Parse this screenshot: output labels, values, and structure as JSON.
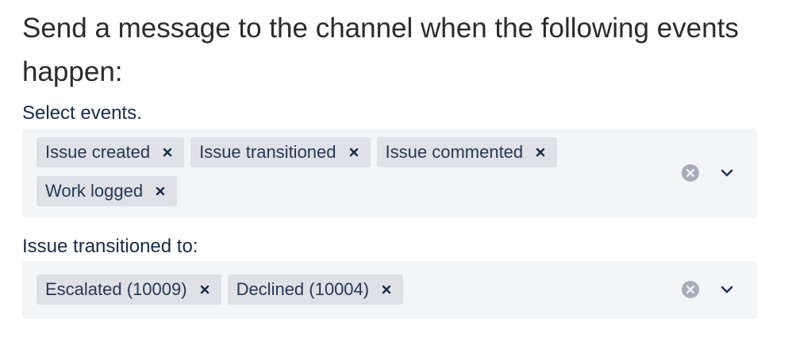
{
  "heading": "Send a message to the channel when the following events happen:",
  "events_field": {
    "label": "Select events.",
    "chips": [
      {
        "label": "Issue created"
      },
      {
        "label": "Issue transitioned"
      },
      {
        "label": "Issue commented"
      },
      {
        "label": "Work logged"
      }
    ],
    "clear_icon": "clear-circle-icon",
    "dropdown_icon": "chevron-down-icon"
  },
  "transition_field": {
    "label": "Issue transitioned to:",
    "chips": [
      {
        "label": "Escalated (10009)"
      },
      {
        "label": "Declined (10004)"
      }
    ],
    "clear_icon": "clear-circle-icon",
    "dropdown_icon": "chevron-down-icon"
  },
  "colors": {
    "label_text": "#172b4d",
    "chip_bg": "#dfe1e6",
    "box_bg": "#f4f5f7",
    "clear_icon": "#a5adba"
  }
}
